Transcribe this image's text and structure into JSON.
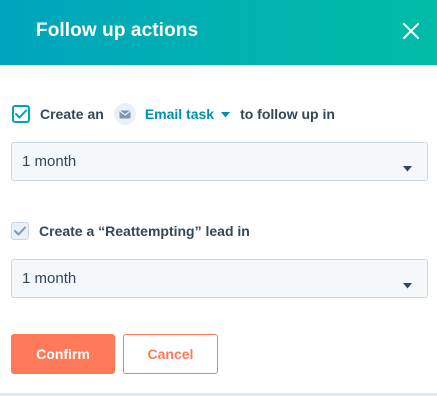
{
  "modal": {
    "title": "Follow up actions",
    "colors": {
      "header_start": "#00a4bd",
      "header_end": "#00bda5",
      "primary": "#ff7a59",
      "link": "#0091ae"
    }
  },
  "task_row": {
    "checked": true,
    "prefix": "Create an",
    "task_type": "Email task",
    "task_type_icon": "email-icon",
    "suffix": "to follow up in"
  },
  "task_delay_select": {
    "value": "1 month"
  },
  "lead_row": {
    "checked": true,
    "disabled": true,
    "label": "Create a “Reattempting” lead in"
  },
  "lead_delay_select": {
    "value": "1 month"
  },
  "buttons": {
    "confirm": "Confirm",
    "cancel": "Cancel"
  }
}
